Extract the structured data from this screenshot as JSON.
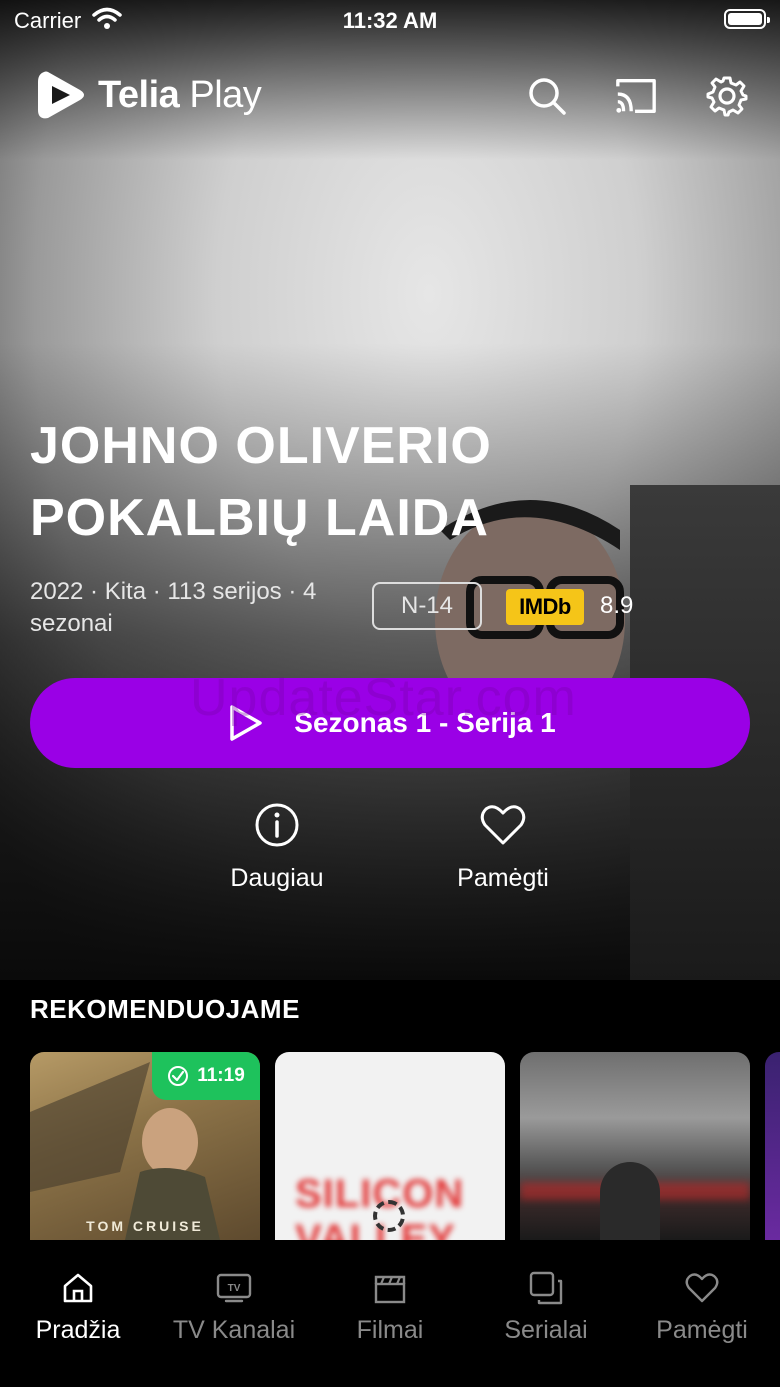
{
  "status_bar": {
    "carrier": "Carrier",
    "time": "11:32 AM"
  },
  "header": {
    "logo_brand": "Telia",
    "logo_product": "Play",
    "icons": [
      "search-icon",
      "cast-icon",
      "settings-icon"
    ]
  },
  "hero": {
    "title_line1": "JOHNO OLIVERIO",
    "title_line2": "POKALBIŲ LAIDA",
    "meta": "2022 · Kita · 113 serijos · 4 sezonai",
    "age_rating": "N-14",
    "imdb_label": "IMDb",
    "imdb_score": "8.9",
    "play_label": "Sezonas 1 - Serija 1",
    "watermark": "UpdateStar.com",
    "accent_color": "#9a00e6"
  },
  "actions": [
    {
      "label": "Daugiau",
      "icon": "info-icon"
    },
    {
      "label": "Pamėgti",
      "icon": "heart-icon"
    }
  ],
  "recommended": {
    "title": "REKOMENDUOJAME",
    "cards": [
      {
        "caption": "TOM CRUISE",
        "progress_time": "11:19"
      },
      {
        "logo": "SILICON VALLEY",
        "loading": true
      },
      {
        "image": "vulture-landscape"
      },
      {
        "image": "partial-card"
      }
    ]
  },
  "tabbar": {
    "tabs": [
      {
        "label": "Pradžia",
        "icon": "home-icon",
        "active": true
      },
      {
        "label": "TV Kanalai",
        "icon": "tv-icon",
        "active": false
      },
      {
        "label": "Filmai",
        "icon": "clapperboard-icon",
        "active": false
      },
      {
        "label": "Serialai",
        "icon": "series-icon",
        "active": false
      },
      {
        "label": "Pamėgti",
        "icon": "heart-icon",
        "active": false
      }
    ]
  }
}
